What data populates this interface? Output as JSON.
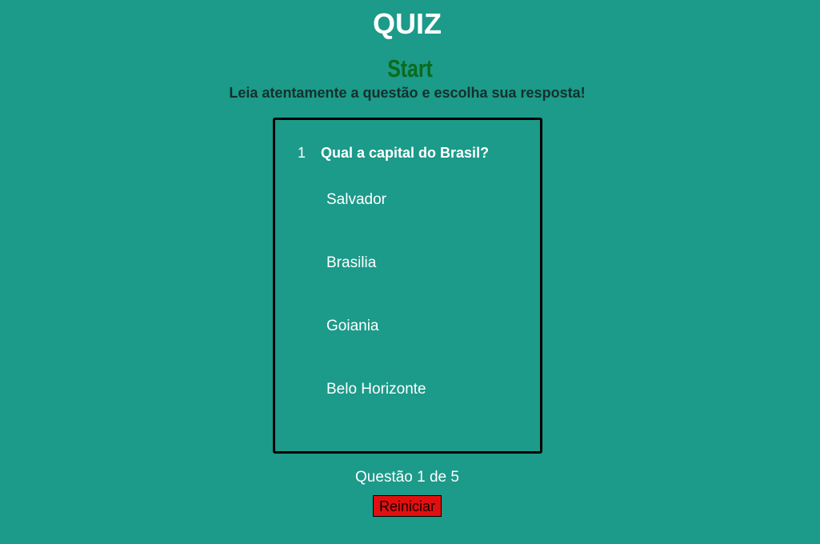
{
  "header": {
    "title": "QUIZ",
    "start_label": "Start",
    "instructions": "Leia atentamente a questão e escolha sua resposta!"
  },
  "question": {
    "number": "1",
    "text": "Qual a capital do Brasil?",
    "options": [
      "Salvador",
      "Brasilia",
      "Goiania",
      "Belo Horizonte"
    ]
  },
  "footer": {
    "progress": "Questão 1 de 5",
    "restart_label": "Reiniciar"
  },
  "colors": {
    "background": "#1c9a8a",
    "start_text": "#0a6b1c",
    "restart_button": "#e01010"
  }
}
